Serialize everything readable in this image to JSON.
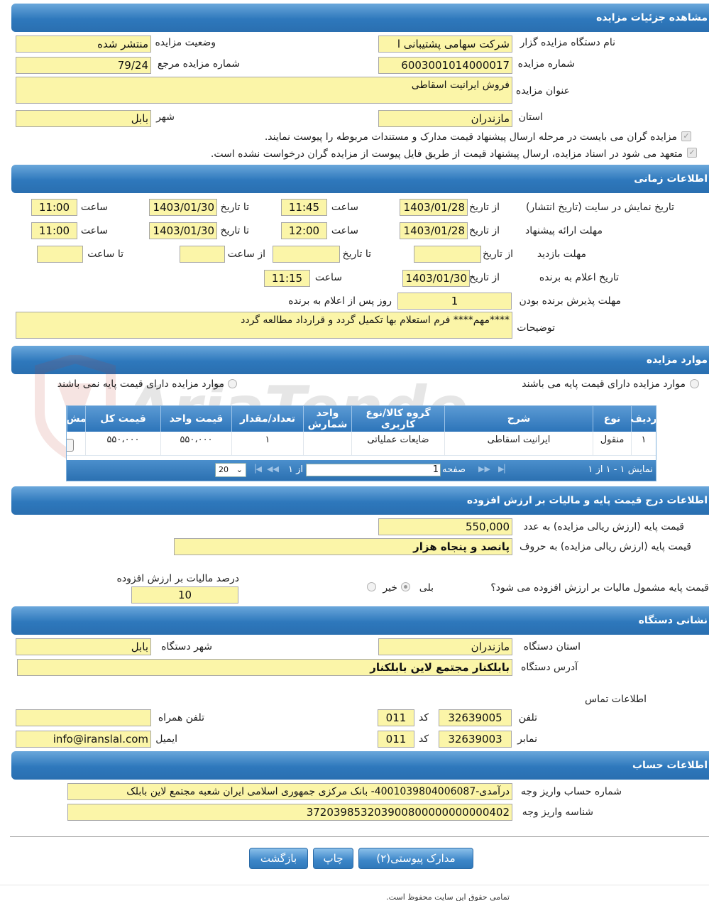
{
  "sections": {
    "details": "مشاهده جزئیات مزایده",
    "timing": "اطلاعات زمانی",
    "items": "موارد مزایده",
    "pricing": "اطلاعات درج قیمت پایه و مالیات بر ارزش افزوده",
    "address": "نشانی دستگاه",
    "account": "اطلاعات حساب"
  },
  "details": {
    "org_label": "نام دستگاه مزایده گزار",
    "org_value": "شرکت سهامی پشتیبانی ا",
    "status_label": "وضعیت مزایده",
    "status_value": "منتشر شده",
    "number_label": "شماره مزایده",
    "number_value": "6003001014000017",
    "ref_label": "شماره مزایده مرجع",
    "ref_value": "79/24",
    "title_label": "عنوان مزایده",
    "title_value": "فروش ایرانیت اسقاطی",
    "province_label": "استان",
    "province_value": "مازندران",
    "city_label": "شهر",
    "city_value": "بابل",
    "check1": "مزایده گران می بایست در مرحله ارسال پیشنهاد قیمت مدارک و مستندات مربوطه را پیوست نمایند.",
    "check2": "متعهد می شود در اسناد مزایده، ارسال پیشنهاد قیمت از طریق فایل پیوست از مزایده گران درخواست نشده است."
  },
  "timing": {
    "from_date": "از تاریخ",
    "to_date": "تا تاریخ",
    "hour": "ساعت",
    "to_hour": "تا ساعت",
    "from_hour": "از ساعت",
    "publish_label": "تاریخ نمایش در سایت (تاریخ انتشار)",
    "publish_from_date": "1403/01/28",
    "publish_from_time": "11:45",
    "publish_to_date": "1403/01/30",
    "publish_to_time": "11:00",
    "offer_label": "مهلت ارائه پیشنهاد",
    "offer_from_date": "1403/01/28",
    "offer_from_time": "12:00",
    "offer_to_date": "1403/01/30",
    "offer_to_time": "11:00",
    "visit_label": "مهلت بازدید",
    "winner_label": "تاریخ اعلام به برنده",
    "winner_date": "1403/01/30",
    "winner_time": "11:15",
    "accept_label": "مهلت پذیرش برنده بودن",
    "accept_value": "1",
    "accept_suffix": "روز پس از اعلام به برنده",
    "desc_label": "توضیحات",
    "desc_value": "****مهم**** فرم استعلام بها تکمیل گردد و قرارداد مطالعه گردد"
  },
  "items": {
    "radio_with_base": "موارد مزایده دارای قیمت پایه می باشند",
    "radio_without_base": "موارد مزایده دارای قیمت پایه نمی باشند",
    "columns": [
      "ردیف",
      "نوع",
      "شرح",
      "گروه کالا/نوع کاربری",
      "واحد شمارش",
      "تعداد/مقدار",
      "قیمت واحد",
      "قیمت کل",
      "مش"
    ],
    "rows": [
      [
        "۱",
        "منقول",
        "ایرانیت اسقاطی",
        "ضایعات عملیاتی",
        "",
        "۱",
        "۵۵۰،۰۰۰",
        "۵۵۰،۰۰۰",
        ""
      ]
    ],
    "pager_display": "نمایش ۱ - ۱ از ۱",
    "pager_page": "صفحه",
    "pager_page_value": "1",
    "pager_of": "از ۱",
    "pager_size": "20"
  },
  "pricing": {
    "base_num_label": "قیمت پایه (ارزش ریالی مزایده) به عدد",
    "base_num_value": "550,000",
    "base_text_label": "قیمت پایه (ارزش ریالی مزایده) به حروف",
    "base_text_value": "پانصد و پنجاه هزار",
    "vat_question": "قیمت پایه مشمول مالیات بر ارزش افزوده می شود؟",
    "yes": "بلی",
    "no": "خیر",
    "vat_percent_label": "درصد مالیات بر ارزش افزوده",
    "vat_percent_value": "10"
  },
  "address": {
    "province_label": "استان دستگاه",
    "province_value": "مازندران",
    "city_label": "شهر دستگاه",
    "city_value": "بابل",
    "address_label": "آدرس دستگاه",
    "address_value": "بابلکنار مجتمع لاین بابلکنار",
    "contact_label": "اطلاعات تماس",
    "phone_label": "تلفن",
    "phone_value": "32639005",
    "code_label": "کد",
    "phone_code": "011",
    "mobile_label": "تلفن همراه",
    "mobile_value": "",
    "fax_label": "نمابر",
    "fax_value": "32639003",
    "fax_code": "011",
    "email_label": "ایمیل",
    "email_value": "info@iranslal.com"
  },
  "account": {
    "account_label": "شماره حساب واریز وجه",
    "account_value": "درآمدی-4001039804006087- بانک مرکزی جمهوری اسلامی ایران شعبه مجتمع لاین بابلک",
    "id_label": "شناسه واریز وجه",
    "id_value": "372039853203900800000000000402"
  },
  "buttons": {
    "attachments": "مدارک پیوستی(۲)",
    "print": "چاپ",
    "back": "بازگشت"
  },
  "footer": "تمامی حقوق این سایت محفوظ است."
}
